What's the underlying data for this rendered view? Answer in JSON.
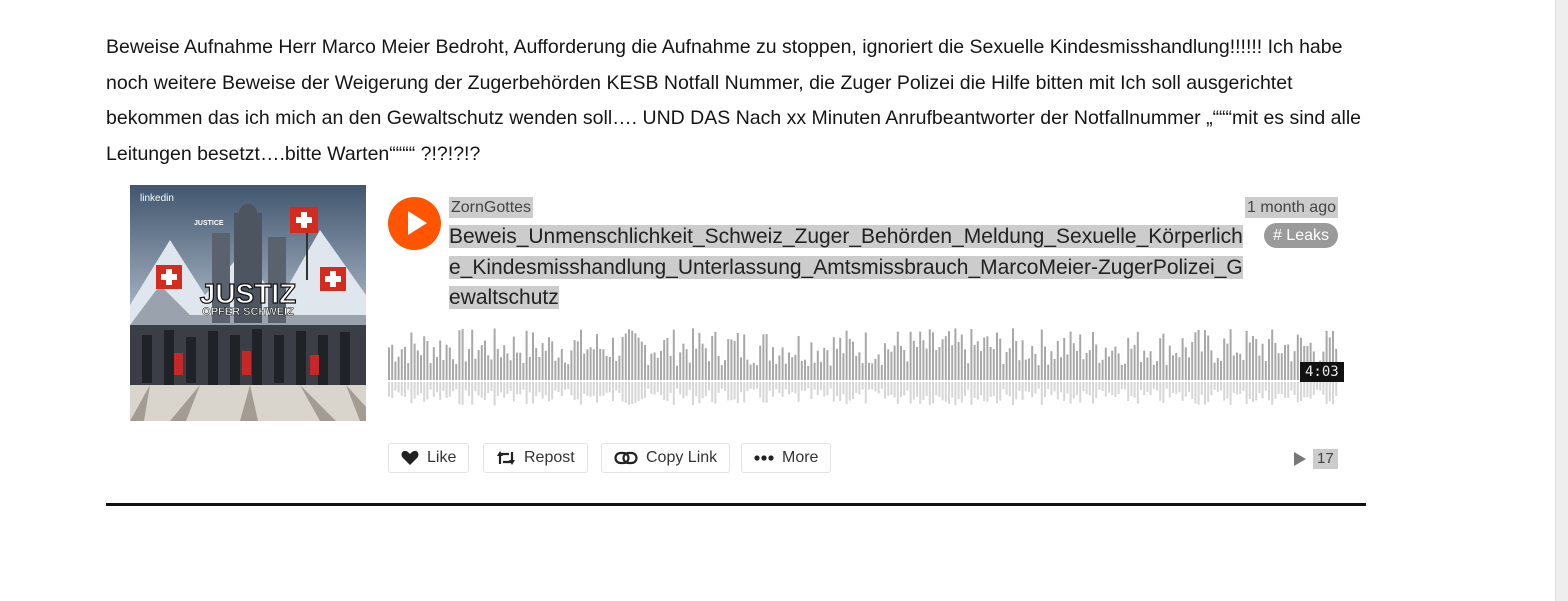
{
  "article": {
    "paragraph": "Beweise Aufnahme Herr Marco Meier Bedroht, Aufforderung die Aufnahme zu stoppen, ignoriert die Sexuelle Kindesmisshandlung!!!!!!   Ich habe noch weitere Beweise der Weigerung der Zugerbehörden KESB Notfall Nummer, die Zuger Polizei die Hilfe bitten mit Ich soll ausgerichtet bekommen das ich mich an den Gewaltschutz wenden soll…. UND DAS Nach xx Minuten  Anrufbeantworter  der Notfallnummer „“““mit es sind alle Leitungen besetzt….bitte Warten““““ ?!?!?!?"
  },
  "player": {
    "artwork": {
      "corner_label": "linkedin",
      "top_label": "JUSTICE",
      "title": "JUSTIZ",
      "subtitle": "OPFER SCHWEIZ"
    },
    "uploader": "ZornGottes",
    "title": "Beweis_Unmenschlichkeit_Schweiz_Zuger_Behörden_Meldung_Sexuelle_Körperliche_Kindesmisshandlung_Unterlassung_Amtsmissbrauch_MarcoMeier-ZugerPolizei_Gewaltschutz",
    "posted": "1 month ago",
    "tag": "# Leaks",
    "duration": "4:03",
    "progress": 0,
    "actions": {
      "like": "Like",
      "repost": "Repost",
      "copy_link": "Copy Link",
      "more": "More"
    },
    "play_count": "17",
    "colors": {
      "accent": "#ff5500",
      "waveform": "#a8a8a8",
      "highlight": "#cccccc"
    }
  }
}
